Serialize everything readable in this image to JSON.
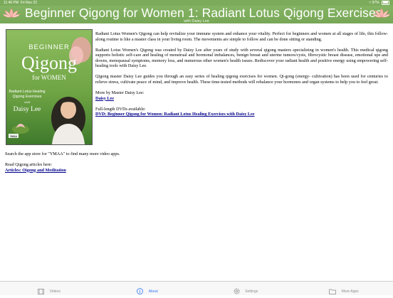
{
  "status_bar": {
    "time": "11:46 PM",
    "date": "Fri Nov 22",
    "battery": "97%"
  },
  "header": {
    "title": "Beginner Qigong for Women 1: Radiant Lotus Qigong Exercises",
    "subtitle": "with Daisy Lee",
    "background_color": "#7dac5c"
  },
  "cover": {
    "title_line1": "BEGINNER",
    "title_line2": "Qigong",
    "title_line3": "for WOMEN",
    "subtitle_line1": "Radiant Lotus Healing",
    "subtitle_line2": "Qigong Exercises",
    "with": "with",
    "author": "Daisy Lee",
    "publisher": "YMAA"
  },
  "about": {
    "paragraphs": [
      "Radiant Lotus Women's Qigong can help revitalize your immune system and enhance your vitality. Perfect for beginners and women at all stages of life, this follow-along routine is like a master class in your living room. The movements are simple to follow and can be done sitting or standing.",
      "Radiant Lotus Women's Qigong was created by Daisy Lee after years of study with several qigong masters specializing in women's health. This medical qigong supports holistic self-care and healing of menstrual and hormonal imbalances, benign breast and uterine tumors/cysts, fibrocystic breast disease, emotional ups and downs, menopausal symptoms, memory loss, and numerous other women's health issues. Rediscover your radiant health and positive energy using empowering self-healing tools with Daisy Lee.",
      "Qigong master Daisy Lee guides you through an easy series of healing qigong exercises for women. Qi-gong (energy- cultivation) has been used for centuries to relieve stress, cultivate peace of mind, and improve health. These time-tested methods will rebalance your hormones and organ systems to help you to feel great."
    ],
    "more_by_label": "More by Master Daisy Lee:",
    "more_by_link": "Daisy Lee",
    "full_length_label": "Full-length DVDs available:",
    "dvd_link": "DVD: Beginner Qigong for Women: Radiant Lotus Healing Exercises with Daisy Lee",
    "search_text": "Search the app store for \"YMAA\" to find many more video apps.",
    "articles_label": "Read Qigong articles here:",
    "articles_link": "Articles: Oigong and Meditation"
  },
  "tab_bar": {
    "tabs": [
      {
        "label": "Videos",
        "icon": "film-icon",
        "active": false
      },
      {
        "label": "About",
        "icon": "info-icon",
        "active": true
      },
      {
        "label": "Settings",
        "icon": "gear-icon",
        "active": false
      },
      {
        "label": "More Apps",
        "icon": "folder-icon",
        "active": false
      }
    ],
    "active_color": "#3478f6",
    "inactive_color": "#8e8e93"
  }
}
